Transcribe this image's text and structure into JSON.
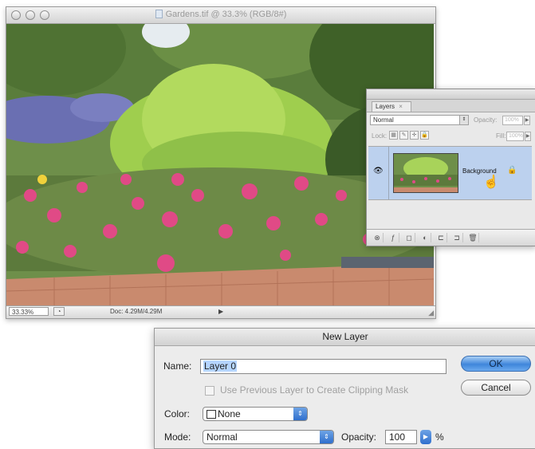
{
  "document_window": {
    "title": "Gardens.tif @ 33.3% (RGB/8#)",
    "status": {
      "zoom": "33.33%",
      "doc_info": "Doc: 4.29M/4.29M"
    }
  },
  "layers_panel": {
    "tab_label": "Layers",
    "blend_mode": "Normal",
    "opacity_label": "Opacity:",
    "opacity_value": "100%",
    "lock_label": "Lock:",
    "fill_label": "Fill:",
    "fill_value": "100%",
    "layer": {
      "name": "Background"
    }
  },
  "new_layer_dialog": {
    "title": "New Layer",
    "name_label": "Name:",
    "name_value": "Layer 0",
    "clipping_checkbox_label": "Use Previous Layer to Create Clipping Mask",
    "clipping_checked": false,
    "color_label": "Color:",
    "color_value": "None",
    "mode_label": "Mode:",
    "mode_value": "Normal",
    "opacity_label": "Opacity:",
    "opacity_value": "100",
    "opacity_unit": "%",
    "ok_label": "OK",
    "cancel_label": "Cancel"
  },
  "colors": {
    "dialog_button_accent": "#3f86db",
    "layer_selected": "#bcd1ee"
  }
}
